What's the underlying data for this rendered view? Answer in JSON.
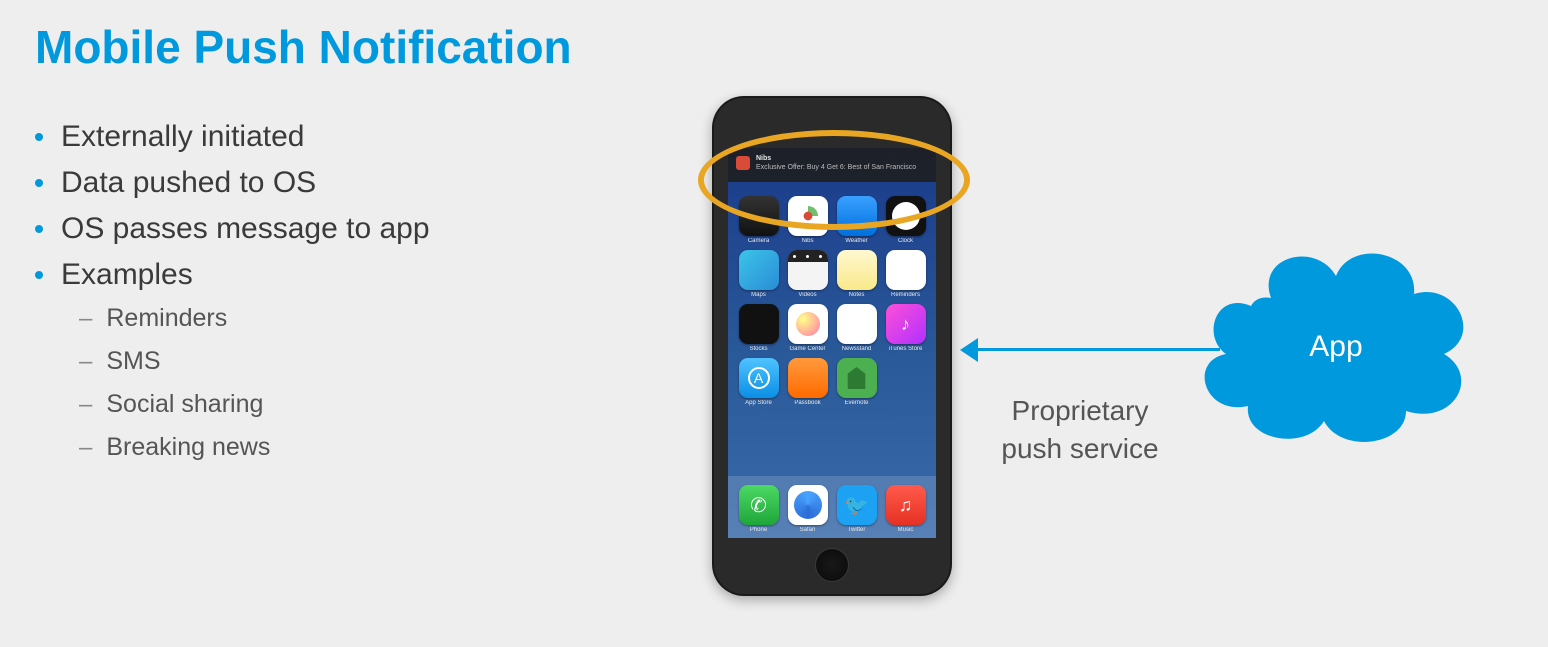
{
  "title": "Mobile Push Notification",
  "bullets": {
    "b0": "Externally initiated",
    "b1": "Data pushed to OS",
    "b2": "OS passes message to app",
    "b3": "Examples"
  },
  "sub_bullets": {
    "s0": "Reminders",
    "s1": "SMS",
    "s2": "Social sharing",
    "s3": "Breaking news"
  },
  "arrow_label": "Proprietary push service",
  "cloud_label": "App",
  "notification": {
    "app_name": "Nibs",
    "body": "Exclusive Offer: Buy 4 Get 6: Best of San Francisco"
  },
  "apps": {
    "row0": [
      "",
      "",
      "",
      ""
    ],
    "row1_labels": [
      "Camera",
      "Nibs",
      "Weather",
      "Clock"
    ],
    "row2_labels": [
      "Maps",
      "Videos",
      "Notes",
      "Reminders"
    ],
    "row3_labels": [
      "Stocks",
      "Game Center",
      "Newsstand",
      "iTunes Store"
    ],
    "row4_labels": [
      "App Store",
      "Passbook",
      "Evernote",
      ""
    ],
    "dock_labels": [
      "Phone",
      "Safari",
      "Twitter",
      "Music"
    ]
  },
  "colors": {
    "accent": "#0099dd",
    "highlight": "#e8a623"
  }
}
